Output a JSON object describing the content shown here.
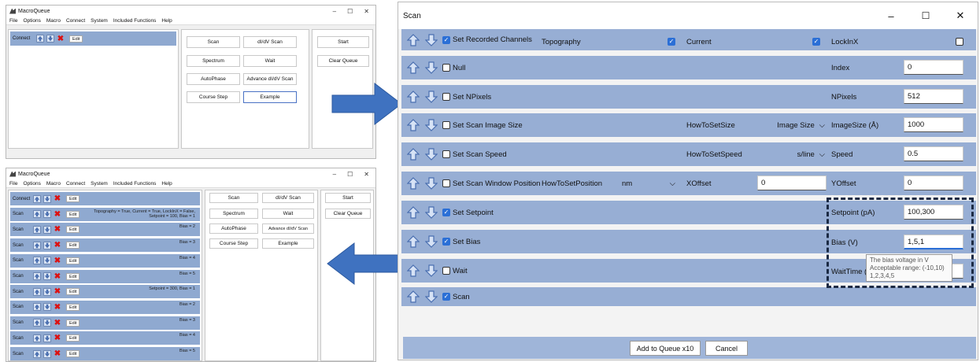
{
  "small_window_top": {
    "title": "MacroQueue",
    "menu": [
      "File",
      "Options",
      "Macro",
      "Connect",
      "System",
      "Included Functions",
      "Help"
    ],
    "queue_row": {
      "label": "Connect",
      "edit": "Edit"
    },
    "function_buttons": [
      "Scan",
      "dI/dV Scan",
      "Spectrum",
      "Wait",
      "AutoPhase",
      "Advance dI/dV Scan",
      "Course Step",
      "Example"
    ],
    "control_buttons": [
      "Start",
      "Clear Queue"
    ]
  },
  "small_window_bottom": {
    "title": "MacroQueue",
    "menu": [
      "File",
      "Options",
      "Macro",
      "Connect",
      "System",
      "Included Functions",
      "Help"
    ],
    "queue_rows": [
      {
        "label": "Connect",
        "edit": "Edit",
        "text": ""
      },
      {
        "label": "Scan",
        "edit": "Edit",
        "text": "Topography = True, Current = True, LockInX = False,\nSetpoint = 100, Bias = 1"
      },
      {
        "label": "Scan",
        "edit": "Edit",
        "text": "Bias = 2"
      },
      {
        "label": "Scan",
        "edit": "Edit",
        "text": "Bias = 3"
      },
      {
        "label": "Scan",
        "edit": "Edit",
        "text": "Bias = 4"
      },
      {
        "label": "Scan",
        "edit": "Edit",
        "text": "Bias = 5"
      },
      {
        "label": "Scan",
        "edit": "Edit",
        "text": "Setpoint = 300, Bias = 1"
      },
      {
        "label": "Scan",
        "edit": "Edit",
        "text": "Bias = 2"
      },
      {
        "label": "Scan",
        "edit": "Edit",
        "text": "Bias = 3"
      },
      {
        "label": "Scan",
        "edit": "Edit",
        "text": "Bias = 4"
      },
      {
        "label": "Scan",
        "edit": "Edit",
        "text": "Bias = 5"
      }
    ],
    "function_buttons": [
      "Scan",
      "dI/dV Scan",
      "Spectrum",
      "Wait",
      "AutoPhase",
      "Advance dI/dV Scan",
      "Course Step",
      "Example"
    ],
    "control_buttons": [
      "Start",
      "Clear Queue"
    ]
  },
  "scan_window": {
    "title": "Scan",
    "rows": {
      "recorded": {
        "label": "Set Recorded Channels",
        "checked": true,
        "topography": "Topography",
        "current": "Current",
        "lockinx": "LockInX"
      },
      "null": {
        "label": "Null",
        "param": "Index",
        "value": "0"
      },
      "npixels": {
        "label": "Set NPixels",
        "param": "NPixels",
        "value": "512"
      },
      "imagesize": {
        "label": "Set Scan Image Size",
        "how": "HowToSetSize",
        "how_value": "Image Size",
        "param": "ImageSize (Å)",
        "value": "1000"
      },
      "speed": {
        "label": "Set Scan Speed",
        "how": "HowToSetSpeed",
        "how_value": "s/line",
        "param": "Speed",
        "value": "0.5"
      },
      "position": {
        "label": "Set Scan Window Position",
        "how": "HowToSetPosition",
        "how_value": "nm",
        "xoffset": "XOffset",
        "xvalue": "0",
        "yoffset": "YOffset",
        "yvalue": "0"
      },
      "setpoint": {
        "label": "Set Setpoint",
        "param": "Setpoint (pA)",
        "value": "100,300"
      },
      "bias": {
        "label": "Set Bias",
        "param": "Bias (V)",
        "value": "1,5,1"
      },
      "wait": {
        "label": "Wait",
        "param": "WaitTime (s)"
      },
      "scan": {
        "label": "Scan"
      }
    },
    "tooltip": {
      "line1": "The bias voltage in V",
      "line2": "Acceptable range: (-10,10)",
      "line3": "1,2,3,4,5"
    },
    "add_button": "Add to Queue x10",
    "cancel_button": "Cancel"
  },
  "colors": {
    "row": "#97aed4",
    "accent": "#2b6fd6",
    "arrow": "#3f72c0"
  }
}
